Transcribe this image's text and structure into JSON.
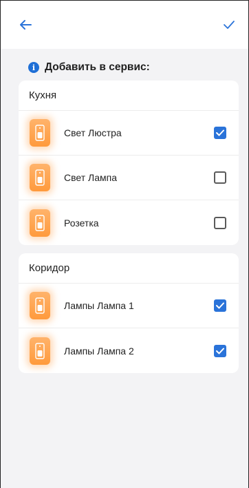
{
  "header": {
    "back_icon": "arrow-left-icon",
    "confirm_icon": "checkmark-icon",
    "accent_color": "#2a73d9"
  },
  "section": {
    "title": "Добавить в сервис:",
    "icon": "info-icon",
    "icon_glyph": "i"
  },
  "groups": [
    {
      "title": "Кухня",
      "items": [
        {
          "label": "Свет Люстра",
          "checked": true,
          "icon": "switch-device-icon"
        },
        {
          "label": "Свет Лампа",
          "checked": false,
          "icon": "switch-device-icon"
        },
        {
          "label": "Розетка",
          "checked": false,
          "icon": "switch-device-icon"
        }
      ]
    },
    {
      "title": "Коридор",
      "items": [
        {
          "label": "Лампы Лампа 1",
          "checked": true,
          "icon": "switch-device-icon"
        },
        {
          "label": "Лампы Лампа 2",
          "checked": true,
          "icon": "switch-device-icon"
        }
      ]
    }
  ]
}
